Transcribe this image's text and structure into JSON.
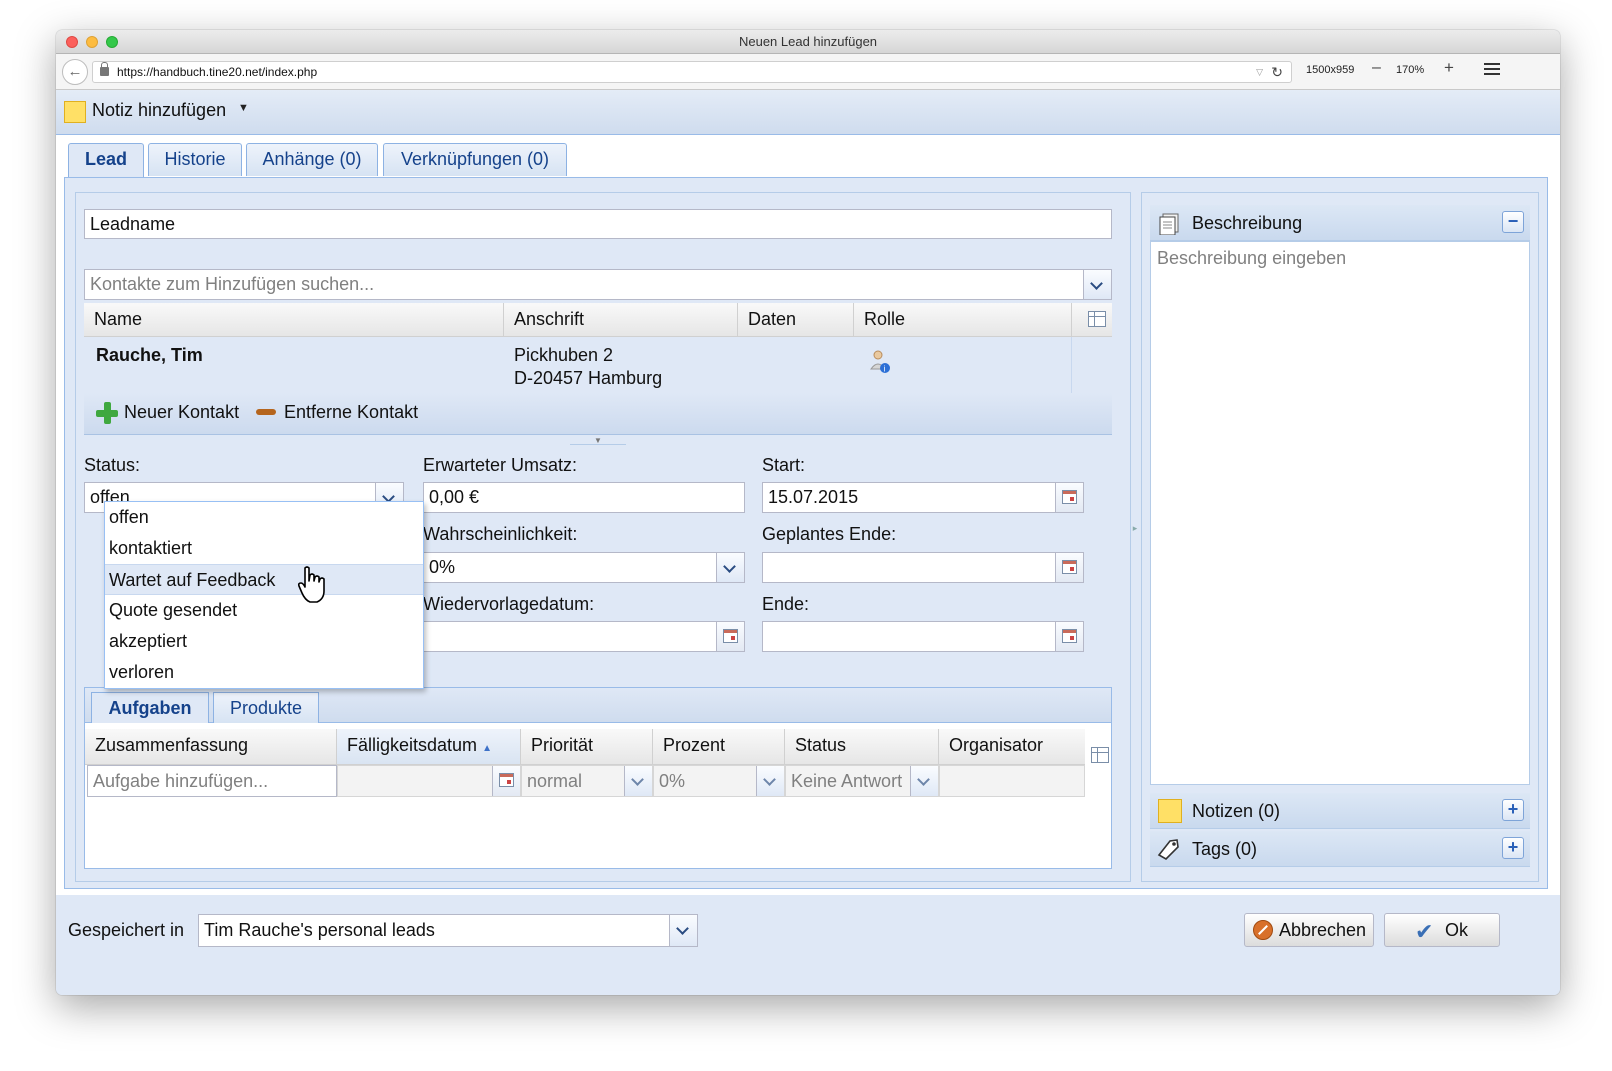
{
  "window": {
    "title": "Neuen Lead hinzufügen"
  },
  "browser": {
    "url": "https://handbuch.tine20.net/index.php",
    "viewport_size": "1500x959",
    "zoom": "170%"
  },
  "toolbar": {
    "add_note_label": "Notiz hinzufügen"
  },
  "tabs": [
    {
      "label": "Lead"
    },
    {
      "label": "Historie"
    },
    {
      "label": "Anhänge (0)"
    },
    {
      "label": "Verknüpfungen (0)"
    }
  ],
  "lead": {
    "name_placeholder": "Leadname",
    "contact_search_placeholder": "Kontakte zum Hinzufügen suchen..."
  },
  "contacts_grid": {
    "columns": [
      "Name",
      "Anschrift",
      "Daten",
      "Rolle"
    ],
    "rows": [
      {
        "name": "Rauche, Tim",
        "address_line1": "Pickhuben 2",
        "address_line2": "D-20457 Hamburg",
        "role_icon": "customer-user-icon"
      }
    ],
    "add_contact_label": "Neuer Kontakt",
    "remove_contact_label": "Entferne Kontakt"
  },
  "form": {
    "status_label": "Status:",
    "status_value": "offen",
    "status_options": [
      "offen",
      "kontaktiert",
      "Wartet auf Feedback",
      "Quote gesendet",
      "akzeptiert",
      "verloren"
    ],
    "status_hovered": "Wartet auf Feedback",
    "turnover_label": "Erwarteter Umsatz:",
    "turnover_value": "0,00 €",
    "probability_label": "Wahrscheinlichkeit:",
    "probability_value": "0%",
    "resubmission_label": "Wiedervorlagedatum:",
    "resubmission_value": "",
    "start_label": "Start:",
    "start_value": "15.07.2015",
    "planned_end_label": "Geplantes Ende:",
    "planned_end_value": "",
    "end_label": "Ende:",
    "end_value": ""
  },
  "subtabs": [
    {
      "label": "Aufgaben"
    },
    {
      "label": "Produkte"
    }
  ],
  "tasks_grid": {
    "columns": [
      "Zusammenfassung",
      "Fälligkeitsdatum",
      "Priorität",
      "Prozent",
      "Status",
      "Organisator"
    ],
    "new_row": {
      "summary_placeholder": "Aufgabe hinzufügen...",
      "priority": "normal",
      "percent": "0%",
      "status": "Keine Antwort"
    }
  },
  "right_panel": {
    "description_title": "Beschreibung",
    "description_placeholder": "Beschreibung eingeben",
    "notes_title": "Notizen (0)",
    "tags_title": "Tags (0)"
  },
  "footer": {
    "saved_in_label": "Gespeichert in",
    "container_value": "Tim Rauche's personal leads",
    "cancel_label": "Abbrechen",
    "ok_label": "Ok"
  },
  "colors": {
    "panel_bg": "#dfe8f6",
    "border_blue": "#99bbe8",
    "tab_text": "#15428b"
  }
}
